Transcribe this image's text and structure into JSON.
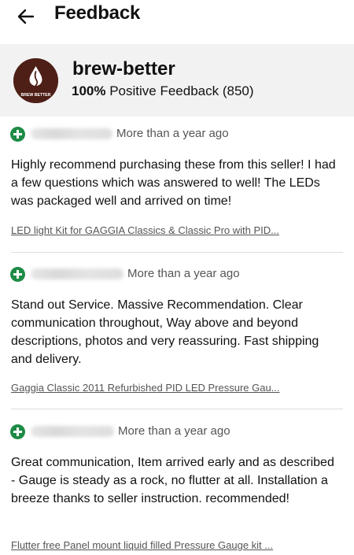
{
  "header": {
    "title": "Feedback"
  },
  "seller": {
    "name": "brew-better",
    "logo_text": "BREW BETTER",
    "positive_pct": "100%",
    "positive_rest": "Positive Feedback (850)"
  },
  "reviews": [
    {
      "time": "More than a year ago",
      "text": "Highly recommend purchasing these from this seller! I had a few questions which was answered to well! The LEDs was packaged well and arrived on time!",
      "item": "LED light Kit for GAGGIA Classics & Classic Pro with PID..."
    },
    {
      "time": "More than a year ago",
      "text": "Stand out Service. Massive Recommendation. Clear communication throughout, Way above and beyond descriptions, photos and very reassuring. Fast shipping and delivery.",
      "item": "Gaggia Classic 2011 Refurbished PID LED Pressure Gau..."
    },
    {
      "time": "More than a year ago",
      "text": "Great communication, Item arrived early and as described - Gauge is steady as a rock, no flutter at all. Installation a breeze thanks to seller instruction. recommended!",
      "item": "Flutter free Panel mount liquid filled Pressure Gauge kit ..."
    }
  ],
  "icons": {
    "back": "arrow-left-icon",
    "positive": "plus-circle-icon"
  },
  "colors": {
    "positive_green": "#1e8b46",
    "logo_bg": "#4e1f17",
    "seller_card_bg": "#f2f2f2",
    "muted_text": "#555555"
  }
}
